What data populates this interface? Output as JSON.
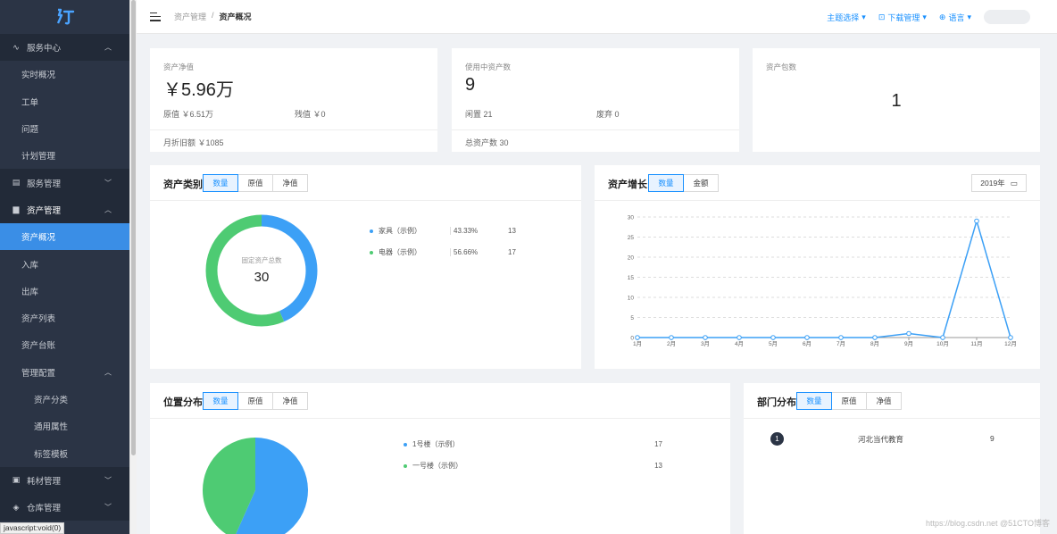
{
  "sidebar": {
    "items": [
      {
        "label": "服务中心",
        "icon": "pulse-icon",
        "kind": "group",
        "arrow": "up"
      },
      {
        "label": "实时概况",
        "kind": "child"
      },
      {
        "label": "工单",
        "kind": "child"
      },
      {
        "label": "问题",
        "kind": "child"
      },
      {
        "label": "计划管理",
        "kind": "child"
      },
      {
        "label": "服务管理",
        "icon": "grid-icon",
        "kind": "group",
        "arrow": "down"
      },
      {
        "label": "资产管理",
        "icon": "document-icon",
        "kind": "group",
        "arrow": "up",
        "bold": true
      },
      {
        "label": "资产概况",
        "kind": "child",
        "active": true
      },
      {
        "label": "入库",
        "kind": "child"
      },
      {
        "label": "出库",
        "kind": "child"
      },
      {
        "label": "资产列表",
        "kind": "child"
      },
      {
        "label": "资产台账",
        "kind": "child"
      },
      {
        "label": "管理配置",
        "kind": "child",
        "arrow": "up"
      },
      {
        "label": "资产分类",
        "kind": "grand"
      },
      {
        "label": "通用属性",
        "kind": "grand"
      },
      {
        "label": "标签模板",
        "kind": "grand"
      },
      {
        "label": "耗材管理",
        "icon": "box-icon",
        "kind": "group",
        "arrow": "down"
      },
      {
        "label": "仓库管理",
        "icon": "layers-icon",
        "kind": "group",
        "arrow": "down"
      }
    ]
  },
  "statusbar": "javascript:void(0)",
  "header": {
    "breadcrumb": [
      "资产管理",
      "/",
      "资产概况"
    ],
    "theme": "主题选择",
    "download": "下载管理",
    "language": "语言"
  },
  "stats": {
    "net": {
      "title": "资产净值",
      "value": "￥5.96万",
      "orig": "原值 ￥6.51万",
      "residual": "残值 ￥0",
      "monthly": "月折旧额 ￥1085"
    },
    "inuse": {
      "title": "使用中资产数",
      "value": "9",
      "idle": "闲置 21",
      "scrapped": "废弃 0",
      "total": "总资产数 30"
    },
    "pack": {
      "title": "资产包数",
      "value": "1"
    }
  },
  "category": {
    "title": "资产类别",
    "tabs": [
      "数量",
      "原值",
      "净值"
    ],
    "center_label": "固定资产总数",
    "center_value": "30",
    "legend": [
      {
        "name": "家具（示例）",
        "pct": "43.33%",
        "count": "13",
        "color": "#3ca0f6"
      },
      {
        "name": "电器（示例）",
        "pct": "56.66%",
        "count": "17",
        "color": "#4ecb73"
      }
    ]
  },
  "growth": {
    "title": "资产增长",
    "tabs": [
      "数量",
      "金额"
    ],
    "year": "2019年"
  },
  "chart_data": {
    "type": "line",
    "x": [
      "1月",
      "2月",
      "3月",
      "4月",
      "5月",
      "6月",
      "7月",
      "8月",
      "9月",
      "10月",
      "11月",
      "12月"
    ],
    "series": [
      {
        "values": [
          0,
          0,
          0,
          0,
          0,
          0,
          0,
          0,
          1,
          0,
          29,
          0
        ]
      }
    ],
    "ylim": [
      0,
      30
    ],
    "yticks": [
      0,
      5,
      10,
      15,
      20,
      25,
      30
    ],
    "color": "#3ca0f6",
    "grid": true
  },
  "location": {
    "title": "位置分布",
    "tabs": [
      "数量",
      "原值",
      "净值"
    ],
    "legend": [
      {
        "name": "1号楼（示例）",
        "value": 17,
        "color": "#3ca0f6"
      },
      {
        "name": "一号楼（示例）",
        "value": 13,
        "color": "#4ecb73"
      }
    ]
  },
  "department": {
    "title": "部门分布",
    "tabs": [
      "数量",
      "原值",
      "净值"
    ],
    "rows": [
      {
        "rank": "1",
        "name": "河北当代教育",
        "count": "9"
      }
    ]
  },
  "watermark": "https://blog.csdn.net @51CTO博客"
}
